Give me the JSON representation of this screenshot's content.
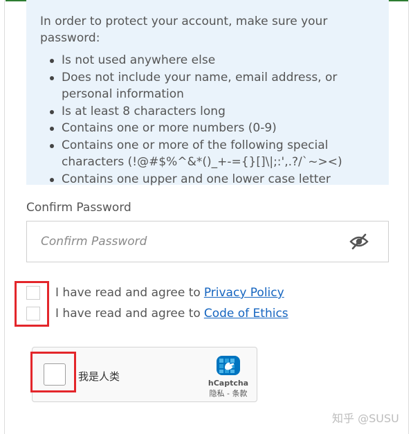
{
  "password_requirements": {
    "intro": "In order to protect your account, make sure your password:",
    "rules": [
      "Is not used anywhere else",
      "Does not include your name, email address, or personal information",
      "Is at least 8 characters long",
      "Contains one or more numbers (0-9)",
      "Contains one or more of the following special characters (!@#$%^&*()_+-={}[]\\|;:',.?/`~><)",
      "Contains one upper and one lower case letter"
    ]
  },
  "confirm_password": {
    "label": "Confirm Password",
    "placeholder": "Confirm Password",
    "value": "",
    "toggle_icon": "eye-slash-icon"
  },
  "agreements": [
    {
      "text": "I have read and agree to",
      "link": "Privacy Policy",
      "checked": false
    },
    {
      "text": "I have read and agree to",
      "link": "Code of Ethics",
      "checked": false
    }
  ],
  "captcha": {
    "label": "我是人类",
    "brand": "hCaptcha",
    "links": "隐私 - 条款",
    "checked": false
  },
  "watermark": "知乎 @SUSU",
  "colors": {
    "info_bg": "#eaf3fb",
    "link": "#1565c0",
    "highlight": "#e3262b",
    "top_accent": "#2e7d32",
    "hcaptcha_brand": "#0074bf"
  }
}
